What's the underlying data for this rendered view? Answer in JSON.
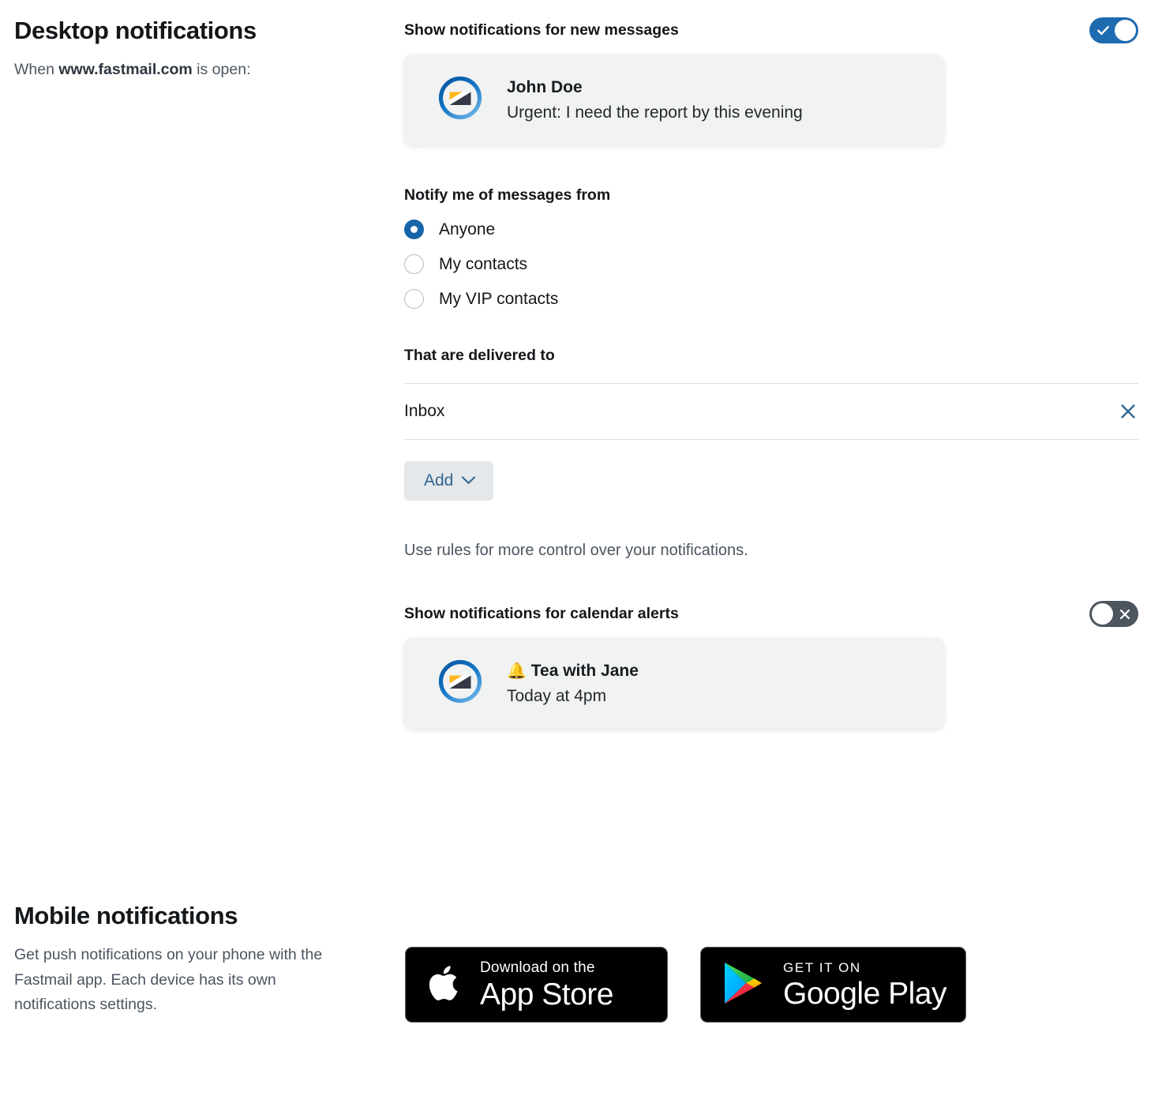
{
  "desktop": {
    "title": "Desktop notifications",
    "description_prefix": "When ",
    "description_bold": "www.fastmail.com",
    "description_suffix": " is open:",
    "messages": {
      "label": "Show notifications for new messages",
      "toggle_state": "on",
      "toggle_icon_on": "check-icon",
      "preview": {
        "sender": "John Doe",
        "body": "Urgent: I need the report by this evening",
        "avatar_icon": "fastmail-logo"
      }
    },
    "notify_from": {
      "label": "Notify me of messages from",
      "options": [
        {
          "label": "Anyone",
          "selected": true
        },
        {
          "label": "My contacts",
          "selected": false
        },
        {
          "label": "My VIP contacts",
          "selected": false
        }
      ]
    },
    "delivered_to": {
      "label": "That are delivered to",
      "items": [
        {
          "name": "Inbox",
          "remove_icon": "close-icon"
        }
      ],
      "add_label": "Add",
      "add_chevron_icon": "chevron-down-icon"
    },
    "rules_note": "Use rules for more control over your notifications.",
    "calendar": {
      "label": "Show notifications for calendar alerts",
      "toggle_state": "off",
      "toggle_icon_off": "close-icon",
      "preview": {
        "bell": "🔔",
        "title": "Tea with Jane",
        "body": "Today at 4pm",
        "avatar_icon": "fastmail-logo"
      }
    }
  },
  "mobile": {
    "title": "Mobile notifications",
    "description": "Get push notifications on your phone with the Fastmail app. Each device has its own notifications settings.",
    "badges": {
      "app_store": {
        "small": "Download on the",
        "big": "App Store",
        "icon": "apple-logo-icon"
      },
      "google_play": {
        "small": "GET IT ON",
        "big": "Google Play",
        "icon": "google-play-icon"
      }
    }
  },
  "colors": {
    "accent_blue": "#1f6bb0",
    "link_blue": "#2f6490",
    "radio_selected": "#1565a8",
    "toggle_off": "#4d555f",
    "card_bg": "#f1f2f2",
    "logo_blue_dark": "#0a5ca8",
    "logo_blue_light": "#5aa9e0",
    "logo_yellow": "#ffb71b",
    "logo_navy": "#333a45"
  }
}
